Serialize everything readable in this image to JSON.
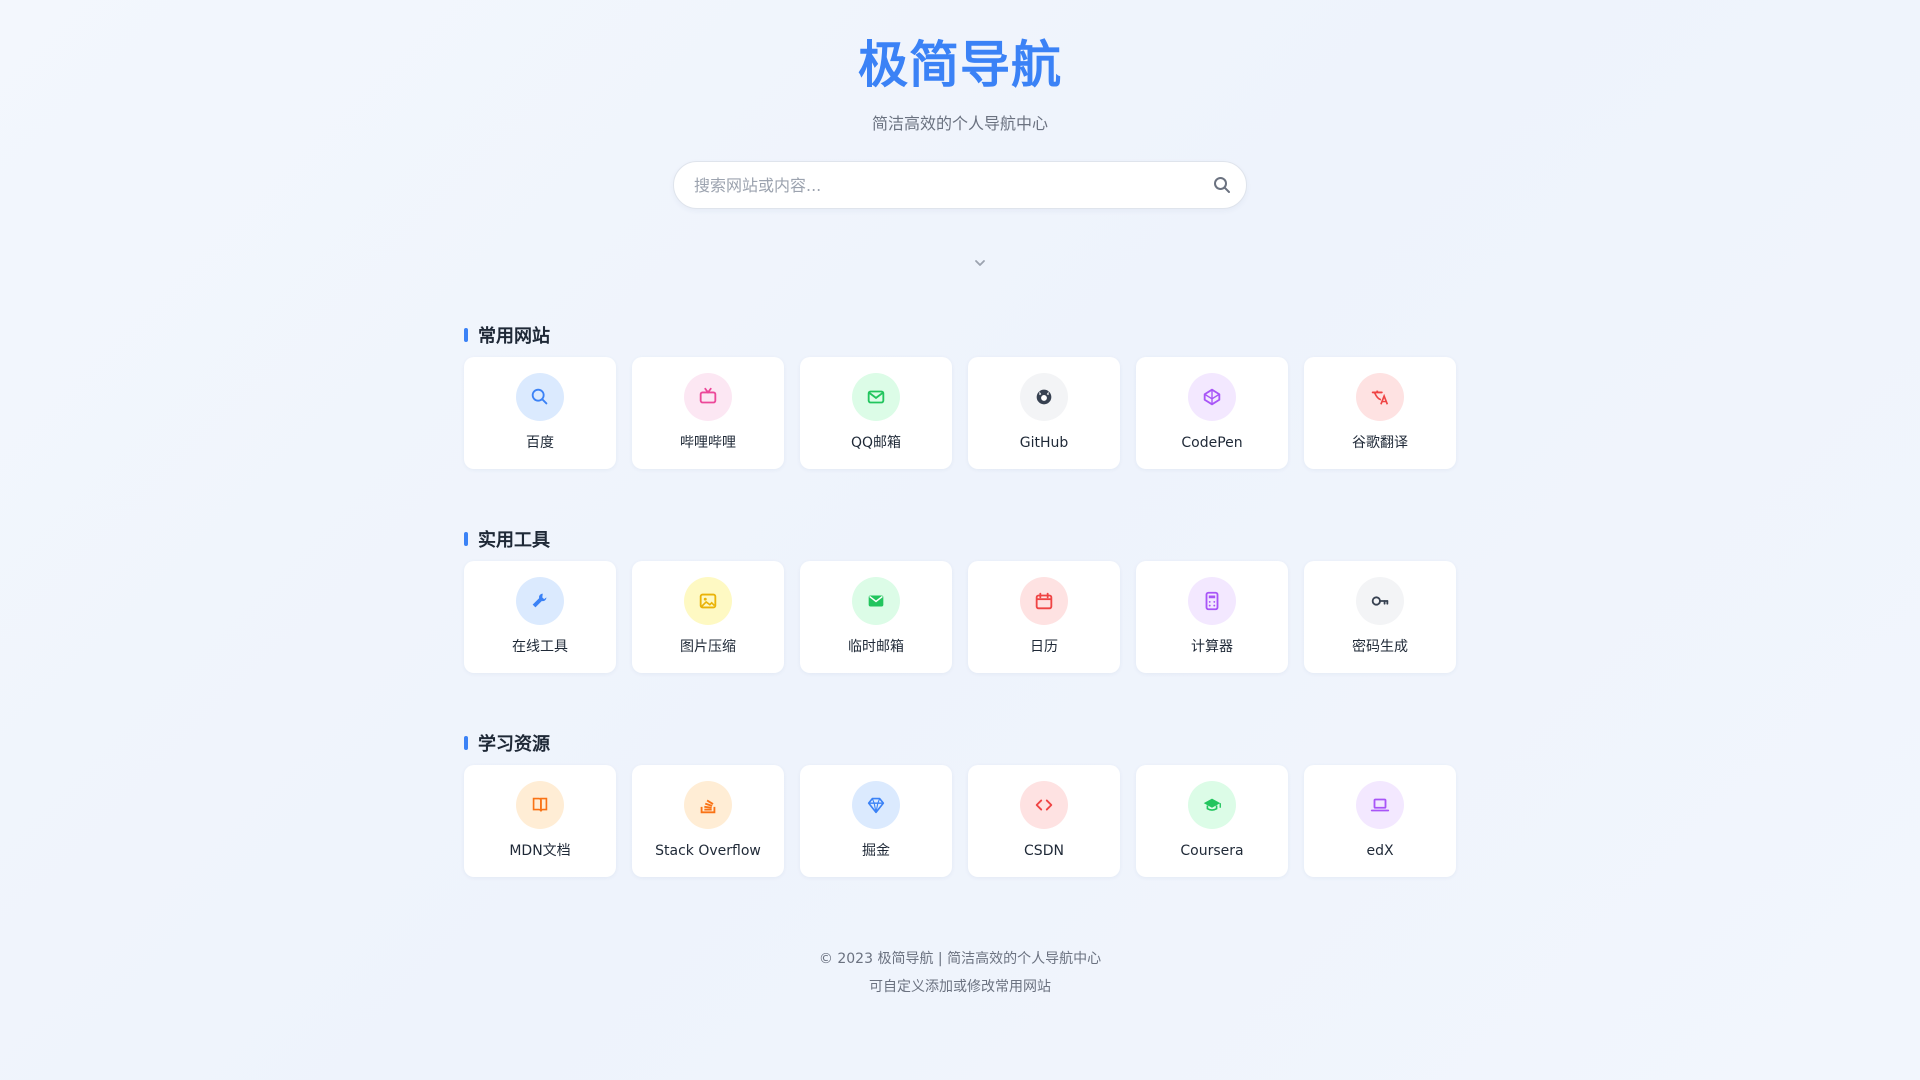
{
  "header": {
    "title": "极简导航",
    "subtitle": "简洁高效的个人导航中心"
  },
  "search": {
    "placeholder": "搜索网站或内容...",
    "value": "",
    "icon": "search-icon"
  },
  "toggle_icon": "chevron-icon",
  "colors": {
    "accent": "#3b82f6",
    "background": "#eef3fc",
    "card": "#ffffff"
  },
  "sections": [
    {
      "title": "常用网站",
      "items": [
        {
          "label": "百度",
          "icon": "search-icon",
          "bg": "#dbeafe",
          "fg": "#3b82f6"
        },
        {
          "label": "哔哩哔哩",
          "icon": "tv-icon",
          "bg": "#fce7f3",
          "fg": "#ec4899"
        },
        {
          "label": "QQ邮箱",
          "icon": "mail-icon",
          "bg": "#dcfce7",
          "fg": "#22c55e"
        },
        {
          "label": "GitHub",
          "icon": "github-icon",
          "bg": "#f3f4f6",
          "fg": "#374151"
        },
        {
          "label": "CodePen",
          "icon": "codepen-icon",
          "bg": "#f3e8ff",
          "fg": "#a855f7"
        },
        {
          "label": "谷歌翻译",
          "icon": "translate-icon",
          "bg": "#fee2e2",
          "fg": "#ef4444"
        }
      ]
    },
    {
      "title": "实用工具",
      "items": [
        {
          "label": "在线工具",
          "icon": "tools-icon",
          "bg": "#dbeafe",
          "fg": "#3b82f6"
        },
        {
          "label": "图片压缩",
          "icon": "image-icon",
          "bg": "#fef9c3",
          "fg": "#eab308"
        },
        {
          "label": "临时邮箱",
          "icon": "envelope-icon",
          "bg": "#dcfce7",
          "fg": "#22c55e"
        },
        {
          "label": "日历",
          "icon": "calendar-icon",
          "bg": "#fee2e2",
          "fg": "#ef4444"
        },
        {
          "label": "计算器",
          "icon": "calculator-icon",
          "bg": "#f3e8ff",
          "fg": "#a855f7"
        },
        {
          "label": "密码生成",
          "icon": "key-icon",
          "bg": "#f3f4f6",
          "fg": "#374151"
        }
      ]
    },
    {
      "title": "学习资源",
      "items": [
        {
          "label": "MDN文档",
          "icon": "book-icon",
          "bg": "#ffedd5",
          "fg": "#f97316"
        },
        {
          "label": "Stack Overflow",
          "icon": "stack-overflow-icon",
          "bg": "#ffedd5",
          "fg": "#f97316"
        },
        {
          "label": "掘金",
          "icon": "gem-icon",
          "bg": "#dbeafe",
          "fg": "#3b82f6"
        },
        {
          "label": "CSDN",
          "icon": "code-icon",
          "bg": "#fee2e2",
          "fg": "#ef4444"
        },
        {
          "label": "Coursera",
          "icon": "graduation-cap-icon",
          "bg": "#dcfce7",
          "fg": "#22c55e"
        },
        {
          "label": "edX",
          "icon": "laptop-icon",
          "bg": "#f3e8ff",
          "fg": "#a855f7"
        }
      ]
    }
  ],
  "footer": {
    "line1": "© 2023 极简导航 | 简洁高效的个人导航中心",
    "line2": "可自定义添加或修改常用网站"
  }
}
